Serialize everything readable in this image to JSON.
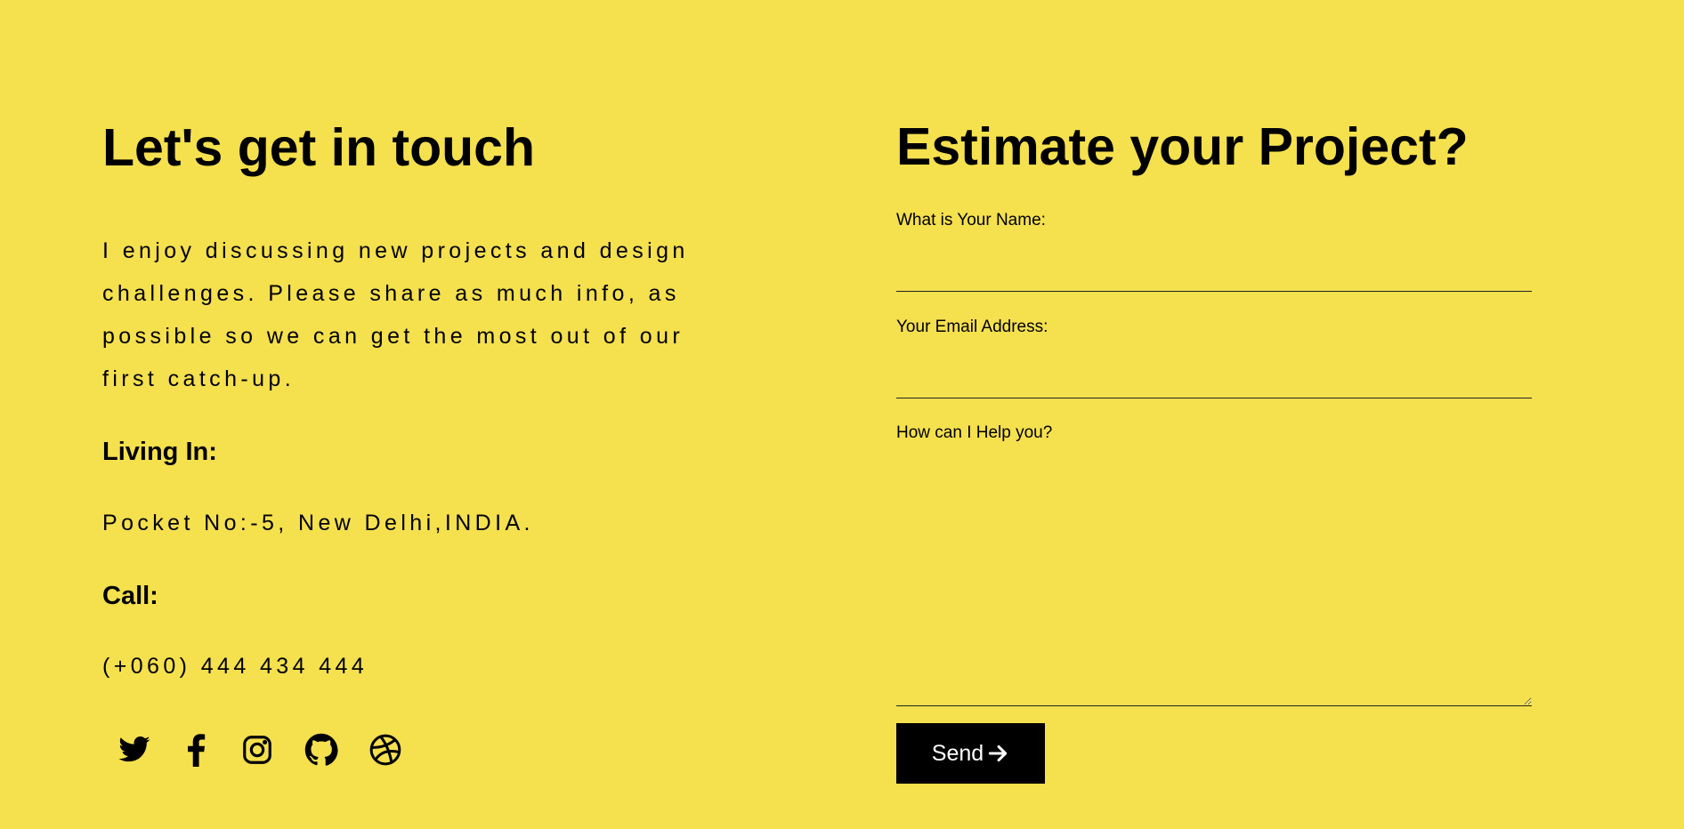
{
  "contact": {
    "title": "Let's get in touch",
    "intro": "I enjoy discussing new projects and design challenges. Please share as much info, as possible so we can get the most out of our first catch-up.",
    "living_heading": "Living In:",
    "address": "Pocket No:-5, New Delhi,INDIA.",
    "call_heading": "Call:",
    "phone": "(+060) 444 434 444",
    "social_icons": [
      "twitter-icon",
      "facebook-icon",
      "instagram-icon",
      "github-icon",
      "dribbble-icon"
    ]
  },
  "form": {
    "title": "Estimate your Project?",
    "name_label": "What is Your Name:",
    "name_value": "",
    "email_label": "Your Email Address:",
    "email_value": "",
    "message_label": "How can I Help you?",
    "message_value": "",
    "send_label": "Send"
  },
  "colors": {
    "background": "#f5e04e",
    "text": "#000000",
    "button_bg": "#000000",
    "button_text": "#ffffff"
  }
}
